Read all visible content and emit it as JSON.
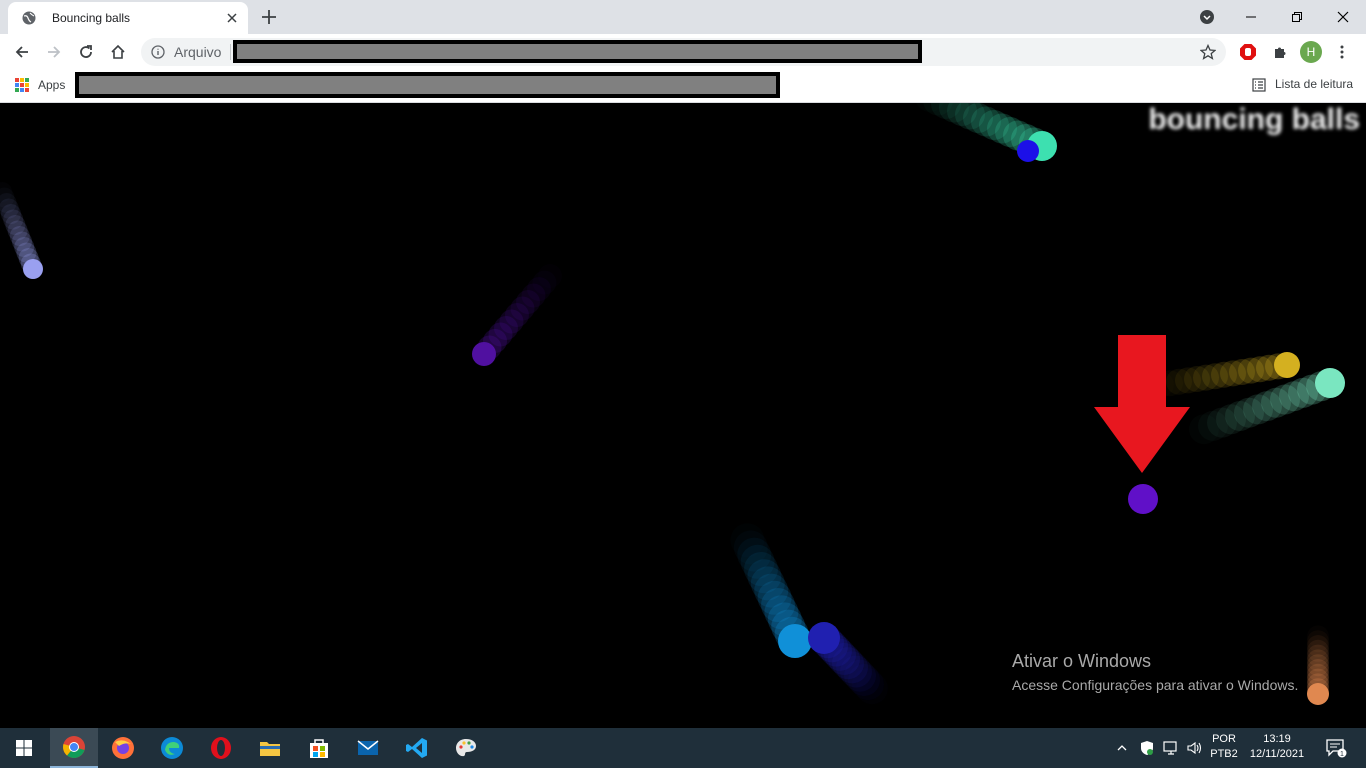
{
  "browser": {
    "tab_title": "Bouncing balls",
    "address_scheme": "Arquivo",
    "profile_initial": "H",
    "bookmarks": {
      "apps_label": "Apps",
      "reading_list_label": "Lista de leitura"
    }
  },
  "page": {
    "heading": "bouncing balls",
    "balls": [
      {
        "color": "#3de0b0",
        "trail": true
      },
      {
        "color": "#1c10e8",
        "trail": false
      },
      {
        "color": "#9aa0f0",
        "trail": true
      },
      {
        "color": "#5010a0",
        "trail": true
      },
      {
        "color": "#d4b020",
        "trail": true
      },
      {
        "color": "#7ae6c0",
        "trail": true
      },
      {
        "color": "#6010c8",
        "trail": false
      },
      {
        "color": "#1090d8",
        "trail": true
      },
      {
        "color": "#2020b0",
        "trail": true
      },
      {
        "color": "#e08850",
        "trail": true
      }
    ],
    "annotation_arrow_color": "#e8171f"
  },
  "windows_activation": {
    "title": "Ativar o Windows",
    "subtitle": "Acesse Configurações para ativar o Windows."
  },
  "taskbar": {
    "apps": [
      "chrome",
      "firefox",
      "edge",
      "opera",
      "file-explorer",
      "store",
      "mail",
      "vscode",
      "paint"
    ],
    "language_line1": "POR",
    "language_line2": "PTB2",
    "time": "13:19",
    "date": "12/11/2021",
    "notification_count": "1"
  }
}
